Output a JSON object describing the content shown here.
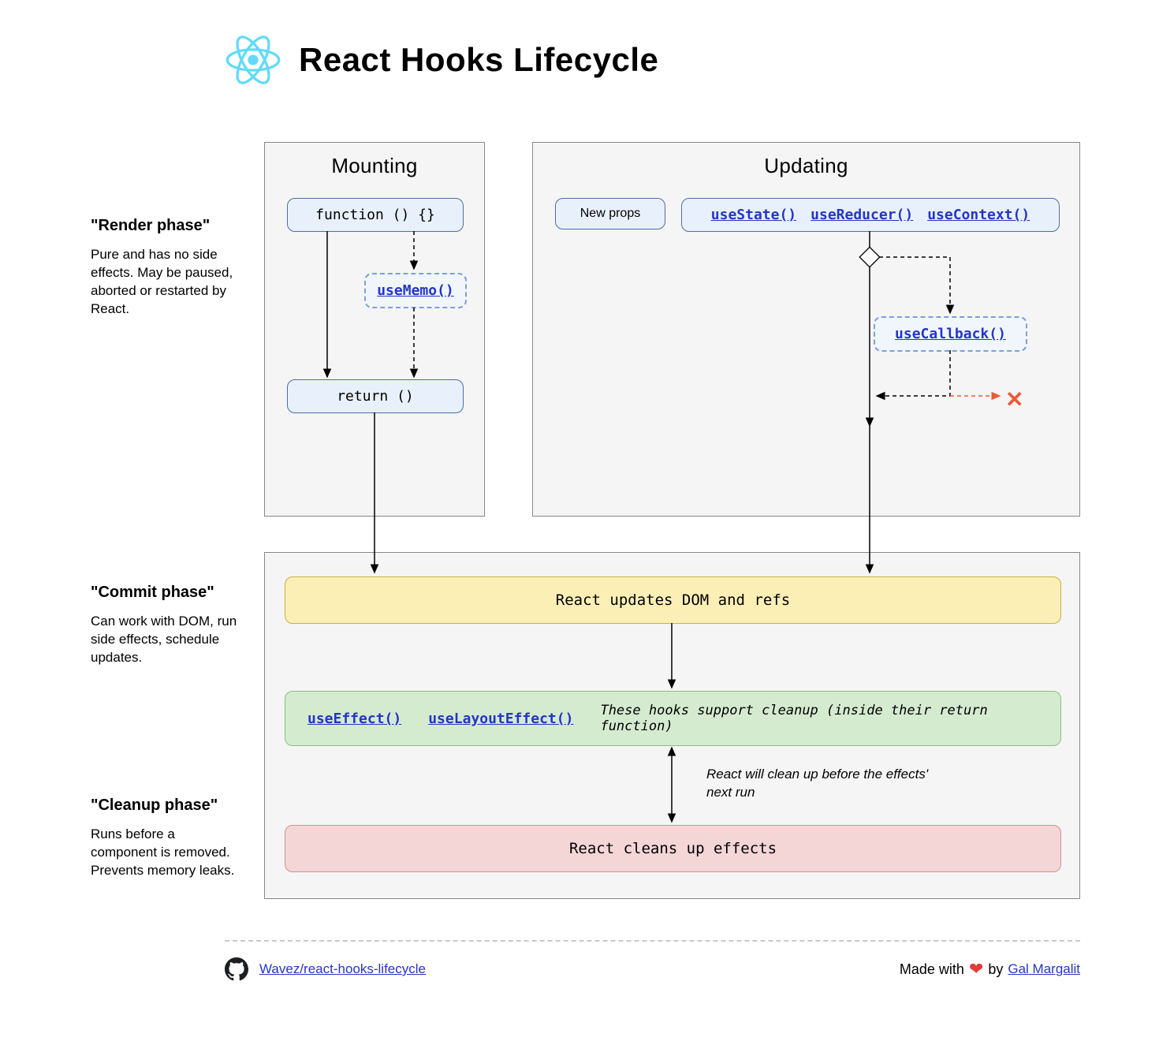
{
  "title": "React Hooks Lifecycle",
  "phases": {
    "render": {
      "heading": "\"Render phase\"",
      "desc": "Pure and has no side effects. May be paused, aborted or restarted by React."
    },
    "commit": {
      "heading": "\"Commit phase\"",
      "desc": "Can work with DOM, run side effects, schedule updates."
    },
    "cleanup": {
      "heading": "\"Cleanup phase\"",
      "desc": "Runs before a component is removed. Prevents memory leaks."
    }
  },
  "mounting": {
    "title": "Mounting",
    "func": "function () {}",
    "usememo": "useMemo()",
    "ret": "return ()"
  },
  "updating": {
    "title": "Updating",
    "newprops": "New props",
    "useState": "useState()",
    "useReducer": "useReducer()",
    "useContext": "useContext()",
    "useCallback": "useCallback()"
  },
  "commit": {
    "dom": "React updates DOM and refs",
    "useEffect": "useEffect()",
    "useLayoutEffect": "useLayoutEffect()",
    "effectsNote": "These hooks support cleanup (inside their return function)",
    "betweenNote": "React will clean up before the effects' next run",
    "cleansUp": "React cleans up effects"
  },
  "footer": {
    "repo": "Wavez/react-hooks-lifecycle",
    "madeWith": "Made with",
    "by": "by",
    "author": "Gal Margalit"
  }
}
